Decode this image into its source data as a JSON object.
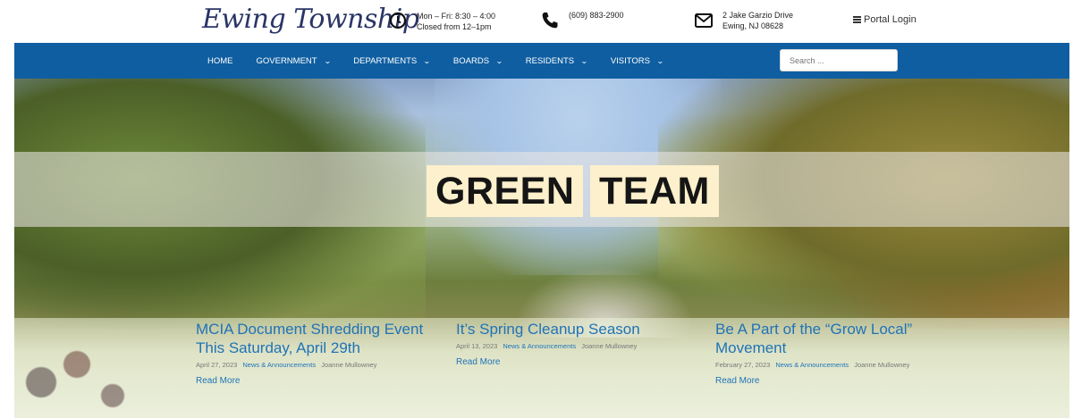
{
  "brand": {
    "logo_text": "Ewing Township"
  },
  "info": {
    "hours_line1": "Mon – Fri: 8:30 – 4:00",
    "hours_line2": "Closed from 12–1pm",
    "phone": "(609) 883-2900",
    "address_line1": "2 Jake Garzio Drive",
    "address_line2": "Ewing, NJ 08628",
    "portal_login": "Portal Login"
  },
  "nav": {
    "items": [
      {
        "label": "HOME",
        "dropdown": false
      },
      {
        "label": "GOVERNMENT",
        "dropdown": true
      },
      {
        "label": "DEPARTMENTS",
        "dropdown": true
      },
      {
        "label": "BOARDS",
        "dropdown": true
      },
      {
        "label": "RESIDENTS",
        "dropdown": true
      },
      {
        "label": "VISITORS",
        "dropdown": true
      }
    ],
    "search_placeholder": "Search ..."
  },
  "hero": {
    "title_word1": "GREEN",
    "title_word2": "TEAM"
  },
  "news": [
    {
      "title": "MCIA Document Shredding Event This Saturday, April 29th",
      "date": "April 27, 2023",
      "category": "News & Announcements",
      "author": "Joanne Mullowney",
      "read_more": "Read More"
    },
    {
      "title": "It’s Spring Cleanup Season",
      "date": "April 13, 2023",
      "category": "News & Announcements",
      "author": "Joanne Mullowney",
      "read_more": "Read More"
    },
    {
      "title": "Be A Part of the “Grow Local” Movement",
      "date": "February 27, 2023",
      "category": "News & Announcements",
      "author": "Joanne Mullowney",
      "read_more": "Read More"
    }
  ],
  "icons": [
    "clock-icon",
    "phone-icon",
    "envelope-icon",
    "menu-icon",
    "chevron-down-icon"
  ],
  "colors": {
    "nav_bg": "#0f5ea1",
    "link": "#1f73b7",
    "title_bg": "#fdf0cc",
    "logo": "#2a3566"
  }
}
